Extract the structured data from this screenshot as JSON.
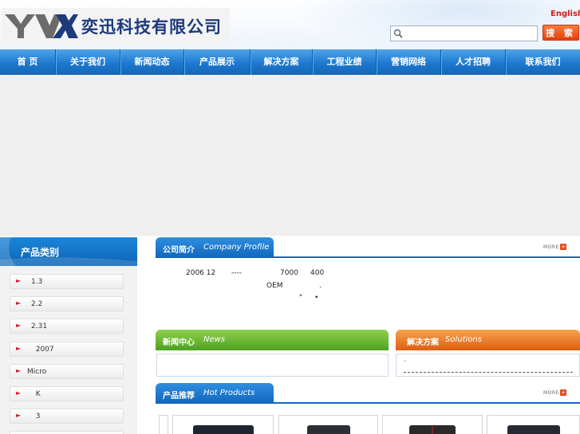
{
  "header": {
    "company_name": "奕迅科技有限公司",
    "english_link": "English",
    "search": {
      "placeholder": "",
      "value": "",
      "button_label": "搜 索"
    }
  },
  "nav": {
    "items": [
      "首  页",
      "关于我们",
      "新闻动态",
      "产品展示",
      "解决方案",
      "工程业绩",
      "营销网络",
      "人才招聘",
      "联系我们"
    ]
  },
  "sidebar": {
    "title": "产品类别",
    "items": [
      {
        "label": "1.3"
      },
      {
        "label": "2.2"
      },
      {
        "label": "2.31"
      },
      {
        "label": "  2007"
      },
      {
        "label": "Micro"
      },
      {
        "label": "  K"
      },
      {
        "label": "  3"
      }
    ]
  },
  "profile": {
    "title_cn": "公司简介",
    "title_en": "Company Profile",
    "more_label": "MORE",
    "lines": [
      {
        "a": "2006 12",
        "b": "----",
        "c": "7000",
        "d": "400"
      },
      {
        "a": "OEM",
        "b": "."
      },
      {
        "a": "\"",
        "b": "•"
      }
    ]
  },
  "news": {
    "title_cn": "新闻中心",
    "title_en": "News"
  },
  "solutions": {
    "title_cn": "解决方案",
    "title_en": "Solutions",
    "item": "."
  },
  "hot_products": {
    "title_cn": "产品推荐",
    "title_en": "Hot Products",
    "more_label": "MORE"
  },
  "colors": {
    "nav_blue": "#1d78cf",
    "brand_red": "#d41b1b",
    "news_green": "#5db52d",
    "solutions_orange": "#e8701a",
    "section_blue": "#1167bd"
  }
}
